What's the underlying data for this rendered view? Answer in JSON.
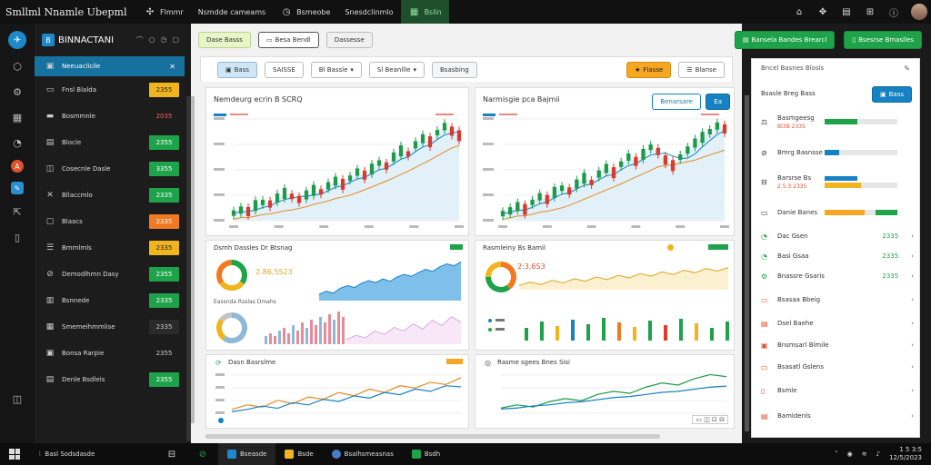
{
  "window": {
    "title": "Smllml Nnamle Ubepml",
    "tabs": [
      {
        "label": "Flmmr",
        "icon": "bug-icon"
      },
      {
        "label": "Nsmdde cameams",
        "icon": ""
      },
      {
        "label": "Bsmeobe",
        "icon": "clock-icon"
      },
      {
        "label": "Snesdclinmlo",
        "icon": ""
      },
      {
        "label": "Bslin",
        "icon": "chart-icon",
        "active": true
      }
    ]
  },
  "sidebar": {
    "brand": "BINNACTANI",
    "items": [
      {
        "label": "Neeuaclicile",
        "badge": "",
        "badge_style": "",
        "active": true
      },
      {
        "label": "Fnsl Blalda",
        "badge": "2355",
        "badge_style": "yellow"
      },
      {
        "label": "Bosmmnle",
        "badge": "2035",
        "badge_style": "red-text"
      },
      {
        "label": "Blocle",
        "badge": "2355",
        "badge_style": "green"
      },
      {
        "label": "Cosecnle Dasle",
        "badge": "3355",
        "badge_style": "green"
      },
      {
        "label": "Bllaccmlo",
        "badge": "2335",
        "badge_style": "green"
      },
      {
        "label": "Blaacs",
        "badge": "2335",
        "badge_style": "orange"
      },
      {
        "label": "Bmmlmls",
        "badge": "2335",
        "badge_style": "yellow"
      },
      {
        "label": "Demodlhmn Dasy",
        "badge": "2355",
        "badge_style": "green"
      },
      {
        "label": "Bsnnede",
        "badge": "2335",
        "badge_style": "green"
      },
      {
        "label": "Smemeihmmlise",
        "badge": "2335",
        "badge_style": "dark"
      },
      {
        "label": "Bonsa Rarpie",
        "badge": "2355",
        "badge_style": "plain"
      },
      {
        "label": "Denle Bsdleis",
        "badge": "2355",
        "badge_style": "green"
      }
    ]
  },
  "toolbar1": {
    "btn1": "Dase Basss",
    "btn2": "Besa Bendl",
    "btn3": "Dassesse"
  },
  "topright": {
    "btn1": "Bansela Bandes Brearcl",
    "btn2": "Bsesrse Bmaslles"
  },
  "toolbar2": {
    "btn1": "Bass",
    "btn2": "SAISSE",
    "btn3": "Bl Bassle",
    "btn4": "Sl Beanllle",
    "btn5": "Bsasbing",
    "btn6": "Flasse",
    "btn7": "Blanse"
  },
  "panels": {
    "p1_title": "Nemdeurg ecrin B SCRQ",
    "p2_title": "Narmisgie pca Bajmii",
    "p2_btn1": "Benarsare",
    "p2_btn2": "Ea",
    "p3_title": "Dsmh Dassles Dr Btsnag",
    "p3_value": "2.86,5523",
    "p3_sub": "Eassnda Rsslas Dmahs",
    "p4_title": "Rasmleiny Bs Bamil",
    "p4_value": "2:3,6S3",
    "p5_title": "Dasn Basrslme",
    "p6_title": "Rasme sgees Bnes Sisi"
  },
  "rpanel": {
    "title": "Bncel Basnes Blosls",
    "subtitle": "Bsasle Breg Bass",
    "btn": "Bass",
    "rows": [
      {
        "label": "Basmgeesg",
        "sub": "Bl3B 2335"
      },
      {
        "label": "Bmrg Basnsse"
      },
      {
        "label": "Barsrse Bs",
        "sub": "2.5,3 2335"
      },
      {
        "label": "Danie Banes"
      },
      {
        "label": "Dac Gsen",
        "value": "2335"
      },
      {
        "label": "Basi Gsaa",
        "value": "2335"
      },
      {
        "label": "Bnassre Gsaris",
        "value": "2335"
      },
      {
        "label": "Bsasaa Bbeig"
      },
      {
        "label": "Dsel Baehe"
      },
      {
        "label": "Bnsmsarl Blmile"
      },
      {
        "label": "Bsasatl Gslens"
      },
      {
        "label": "Bsmle"
      },
      {
        "label": "Bamldenls"
      }
    ]
  },
  "taskbar": {
    "search": "Basl Sodsdasde",
    "items": [
      "Bseasde",
      "Bsde",
      "Bsalhsmeasnas",
      "Bsdh"
    ],
    "time": "1 5 3:5",
    "date": "12/5/2023"
  },
  "chart_data": [
    {
      "type": "line",
      "panel": "candlestick-left",
      "series": [
        {
          "values": [
            2.1,
            2.3,
            2.2,
            2.6,
            2.8,
            2.7,
            3.1,
            3.4,
            3.2,
            3.0,
            3.3,
            3.6,
            3.5,
            3.9,
            4.2,
            4.0,
            4.4,
            4.8,
            4.6,
            5.0,
            5.4,
            5.2,
            5.8,
            6.2,
            6.0,
            6.6,
            7.0,
            6.8,
            7.4,
            7.8,
            7.5,
            7.2
          ]
        }
      ]
    },
    {
      "type": "line",
      "panel": "candlestick-right",
      "series": [
        {
          "values": [
            1.8,
            2.0,
            2.3,
            2.1,
            2.6,
            3.0,
            2.8,
            3.3,
            3.6,
            3.4,
            3.9,
            4.3,
            4.0,
            4.6,
            5.0,
            4.7,
            5.3,
            5.8,
            5.5,
            6.0,
            6.5,
            6.2,
            5.6,
            5.2,
            5.8,
            6.3,
            6.8,
            7.2,
            7.6,
            8.0,
            7.8
          ]
        }
      ]
    },
    {
      "type": "area",
      "panel": "area-blue",
      "series": [
        {
          "values": [
            3,
            3.5,
            3.2,
            4,
            4.4,
            4.1,
            4.8,
            5.2,
            4.9,
            5.5,
            5.1,
            5.8,
            6.2,
            5.9,
            6.5,
            7,
            6.7,
            7.4,
            7.9,
            7.6,
            8.2
          ]
        }
      ]
    },
    {
      "type": "line",
      "panel": "line-yellow",
      "series": [
        {
          "values": [
            3,
            3.4,
            3.1,
            3.6,
            3.3,
            3.8,
            3.5,
            4,
            3.7,
            4.2,
            3.9,
            4.4,
            4.1,
            4.6,
            4.3,
            4.8,
            4.5,
            5,
            4.7,
            5.1
          ]
        }
      ]
    },
    {
      "type": "line",
      "panel": "line-bottom-left",
      "series": [
        {
          "values": [
            1,
            1.4,
            1.2,
            1.8,
            1.5,
            2.1,
            1.9,
            2.5,
            2.2,
            2.8,
            2.5,
            3.1,
            2.9,
            3.4,
            3.2,
            3.8
          ]
        },
        {
          "values": [
            0.8,
            1.0,
            1.3,
            1.1,
            1.6,
            1.4,
            1.9,
            1.7,
            2.2,
            2.0,
            2.5,
            2.3,
            2.8,
            2.6,
            3.1,
            3.0
          ]
        }
      ]
    },
    {
      "type": "line",
      "panel": "line-bottom-right",
      "series": [
        {
          "values": [
            1,
            1.3,
            1.1,
            1.6,
            1.9,
            1.7,
            2.3,
            2.6,
            2.4,
            3.0,
            3.4,
            3.2,
            3.8,
            4.2,
            4.0
          ]
        },
        {
          "values": [
            0.9,
            1.0,
            1.2,
            1.3,
            1.5,
            1.6,
            1.8,
            2.0,
            2.1,
            2.3,
            2.5,
            2.6,
            2.8,
            3.0,
            3.1
          ]
        }
      ]
    }
  ],
  "colors": {
    "accent": "#1682c4",
    "green": "#1ea34a",
    "orange": "#f07a22",
    "yellow": "#f0b41c",
    "red": "#e23b2e"
  }
}
